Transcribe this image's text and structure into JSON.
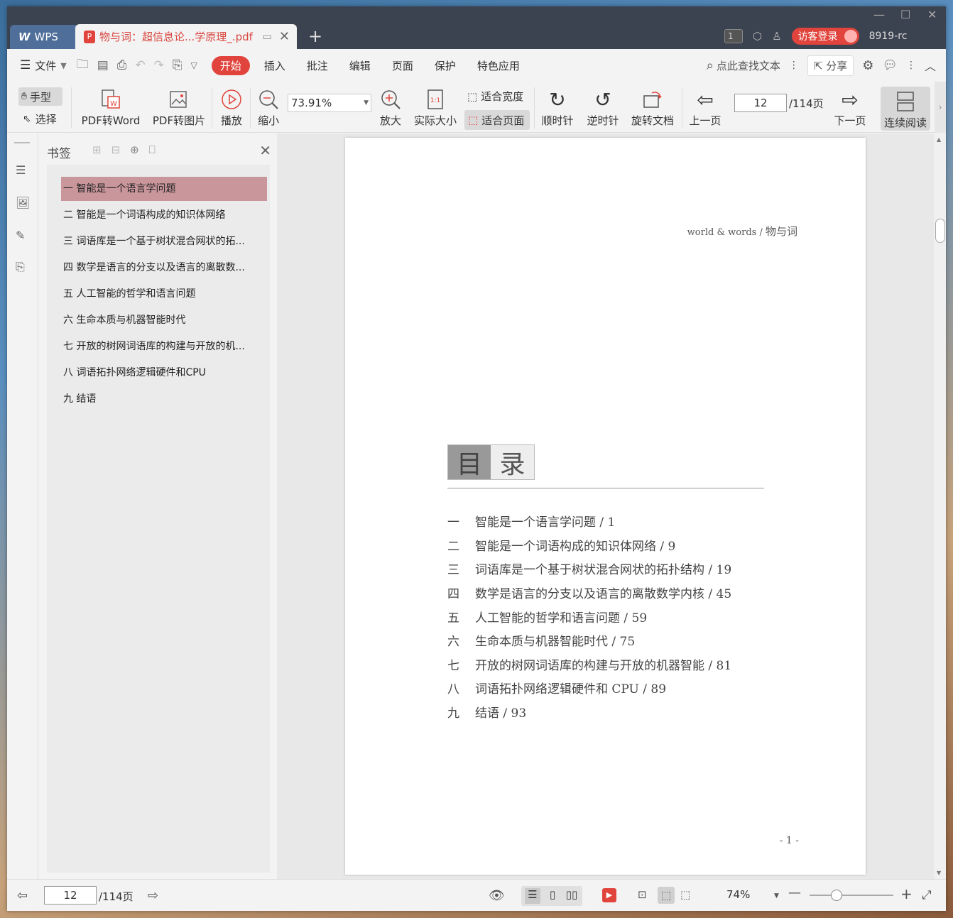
{
  "window": {
    "tabs": {
      "wps_label": "WPS",
      "document_title": "物与词：超信息论...学原理_.pdf"
    },
    "titlebar_right": {
      "badge": "1",
      "login_label": "访客登录",
      "user": "8919-rc"
    }
  },
  "menu": {
    "file": "文件",
    "items": [
      "开始",
      "插入",
      "批注",
      "编辑",
      "页面",
      "保护",
      "特色应用"
    ],
    "search": "点此查找文本",
    "share": "分享"
  },
  "toolbar": {
    "hand": "手型",
    "select": "选择",
    "pdf_to_word": "PDF转Word",
    "pdf_to_image": "PDF转图片",
    "play": "播放",
    "zoom_out": "缩小",
    "zoom_value": "73.91%",
    "zoom_in": "放大",
    "actual_size": "实际大小",
    "fit_width": "适合宽度",
    "fit_page": "适合页面",
    "clockwise": "顺时针",
    "counterclockwise": "逆时针",
    "rotate_doc": "旋转文档",
    "prev_page": "上一页",
    "page_current": "12",
    "page_total": "/114页",
    "next_page": "下一页",
    "continuous": "连续阅读"
  },
  "bookmarks": {
    "title": "书签",
    "items": [
      "一 智能是一个语言学问题",
      "二 智能是一个词语构成的知识体网络",
      "三 词语库是一个基于树状混合网状的拓...",
      "四 数学是语言的分支以及语言的离散数...",
      "五 人工智能的哲学和语言问题",
      "六 生命本质与机器智能时代",
      "七 开放的树网词语库的构建与开放的机...",
      "八 词语拓扑网络逻辑硬件和CPU",
      "九 结语"
    ]
  },
  "page": {
    "header_en": "world & words /",
    "header_cn": "物与词",
    "mulu_a": "目",
    "mulu_b": "录",
    "toc": [
      {
        "num": "一",
        "text": "智能是一个语言学问题 / 1"
      },
      {
        "num": "二",
        "text": "智能是一个词语构成的知识体网络 / 9"
      },
      {
        "num": "三",
        "text": "词语库是一个基于树状混合网状的拓扑结构 / 19"
      },
      {
        "num": "四",
        "text": "数学是语言的分支以及语言的离散数学内核 / 45"
      },
      {
        "num": "五",
        "text": "人工智能的哲学和语言问题 / 59"
      },
      {
        "num": "六",
        "text": "生命本质与机器智能时代 / 75"
      },
      {
        "num": "七",
        "text": "开放的树网词语库的构建与开放的机器智能 / 81"
      },
      {
        "num": "八",
        "text": "词语拓扑网络逻辑硬件和 CPU / 89"
      },
      {
        "num": "九",
        "text": "结语 / 93"
      }
    ],
    "page_number": "- 1 -"
  },
  "status": {
    "page_current": "12",
    "page_total": "/114页",
    "zoom": "74%",
    "zoom_slider_value": 0.32
  }
}
